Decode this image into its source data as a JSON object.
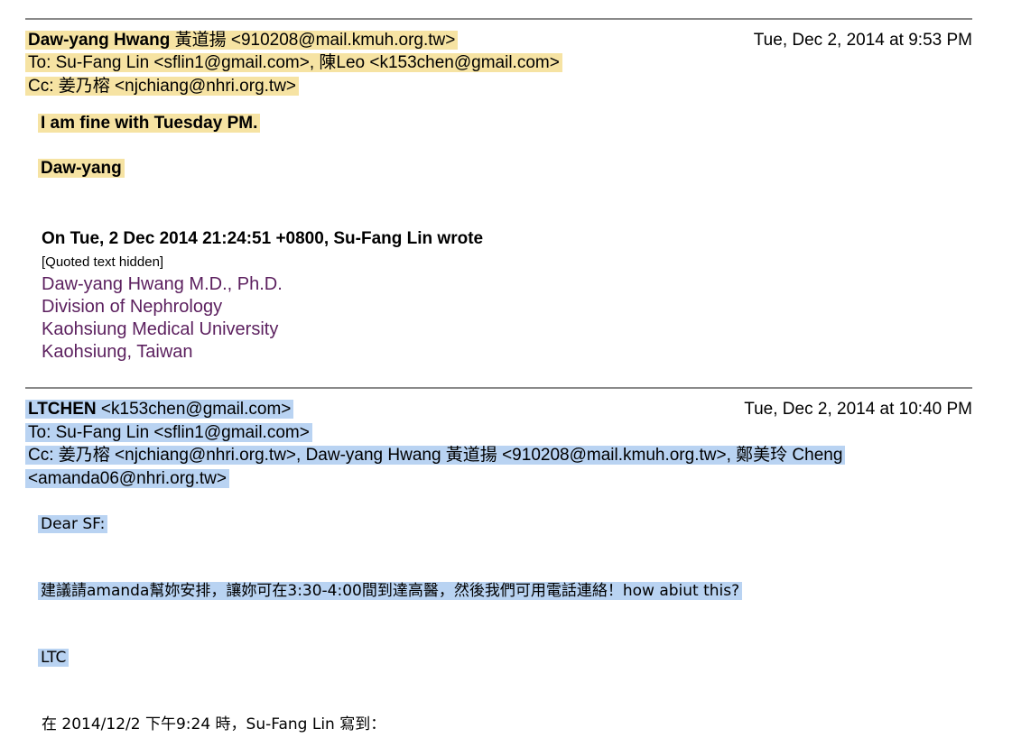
{
  "email1": {
    "from_name": "Daw-yang Hwang",
    "from_rest": " 黃道揚 <910208@mail.kmuh.org.tw>",
    "date": "Tue, Dec 2, 2014 at 9:53 PM",
    "to": "To: Su-Fang Lin <sflin1@gmail.com>, 陳Leo <k153chen@gmail.com>",
    "cc": "Cc: 姜乃榕 <njchiang@nhri.org.tw>",
    "body_line1": "I am fine with Tuesday PM.",
    "body_line2": "Daw-yang",
    "quote_header": "On Tue, 2 Dec 2014 21:24:51 +0800, Su-Fang Lin wrote",
    "quoted_hidden": "[Quoted text hidden]",
    "signature": [
      "Daw-yang Hwang M.D., Ph.D.",
      "Division of Nephrology",
      "Kaohsiung Medical University",
      "Kaohsiung, Taiwan"
    ]
  },
  "email2": {
    "from_name": "LTCHEN",
    "from_rest": " <k153chen@gmail.com>",
    "date": "Tue, Dec 2, 2014 at 10:40 PM",
    "to": "To: Su-Fang Lin <sflin1@gmail.com>",
    "cc_line1": "Cc: 姜乃榕 <njchiang@nhri.org.tw>, Daw-yang Hwang 黃道揚 <910208@mail.kmuh.org.tw>, 鄭美玲 Cheng",
    "cc_line2": "<amanda06@nhri.org.tw>",
    "greeting": "Dear SF:",
    "body": "建議請amanda幫妳安排，讓妳可在3:30-4:00間到達高醫，然後我們可用電話連絡！how abiut this?",
    "signoff": "LTC",
    "next_line_partial": "在 2014/12/2 下午9:24 時，Su-Fang Lin 寫到："
  },
  "colors": {
    "highlight_yellow": "#f6e3a3",
    "highlight_blue": "#b9d3f2",
    "signature_purple": "#5b1f5e",
    "rule_gray": "#8a8a8a"
  }
}
